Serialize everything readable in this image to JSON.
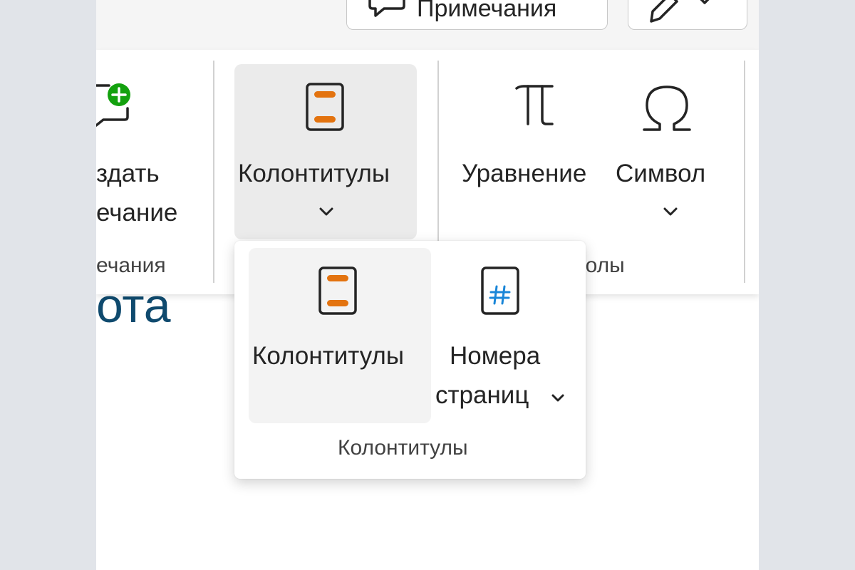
{
  "topbar": {
    "notes_button_label": "Примечания",
    "notes_icon": "comment-icon",
    "edit_icon": "pen-icon"
  },
  "ribbon": {
    "groups": {
      "comments": {
        "button_line1": "здать",
        "button_line2": "ечание",
        "label": "ечания",
        "icon": "new-comment-icon"
      },
      "header_footer": {
        "button_label": "Колонтитулы",
        "icon": "header-footer-icon"
      },
      "symbols": {
        "equation_label": "Уравнение",
        "equation_icon": "pi-icon",
        "symbol_label": "Символ",
        "symbol_icon": "omega-icon",
        "label": "волы"
      }
    }
  },
  "document": {
    "visible_text": "ота"
  },
  "dropdown": {
    "items": [
      {
        "label": "Колонтитулы",
        "icon": "header-footer-icon"
      },
      {
        "label_line1": "Номера",
        "label_line2": "страниц",
        "icon": "page-number-icon"
      }
    ],
    "group_label": "Колонтитулы"
  },
  "colors": {
    "accent_orange": "#e3730f",
    "accent_blue": "#1a86d8",
    "add_green": "#13a10e",
    "document_text": "#0f4a6e"
  }
}
